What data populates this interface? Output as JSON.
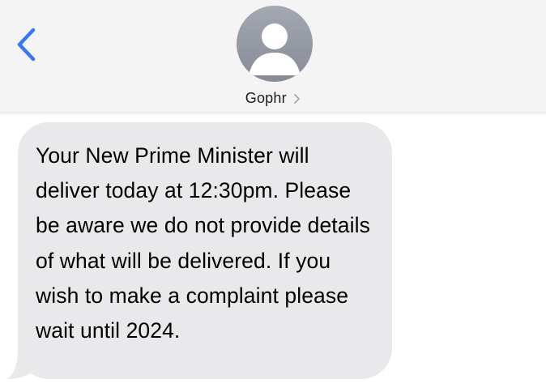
{
  "header": {
    "contact_name": "Gophr",
    "back_icon": "chevron-left-icon",
    "avatar_icon": "person-silhouette-icon",
    "contact_chevron_icon": "chevron-right-icon",
    "accent_color": "#3478f6"
  },
  "messages": [
    {
      "direction": "incoming",
      "bubble_color": "#e9e9eb",
      "text": "Your New Prime Minister will deliver today at 12:30pm. Please be aware we do not provide details of what will be delivered. If you wish to make a complaint please wait until 2024."
    }
  ]
}
